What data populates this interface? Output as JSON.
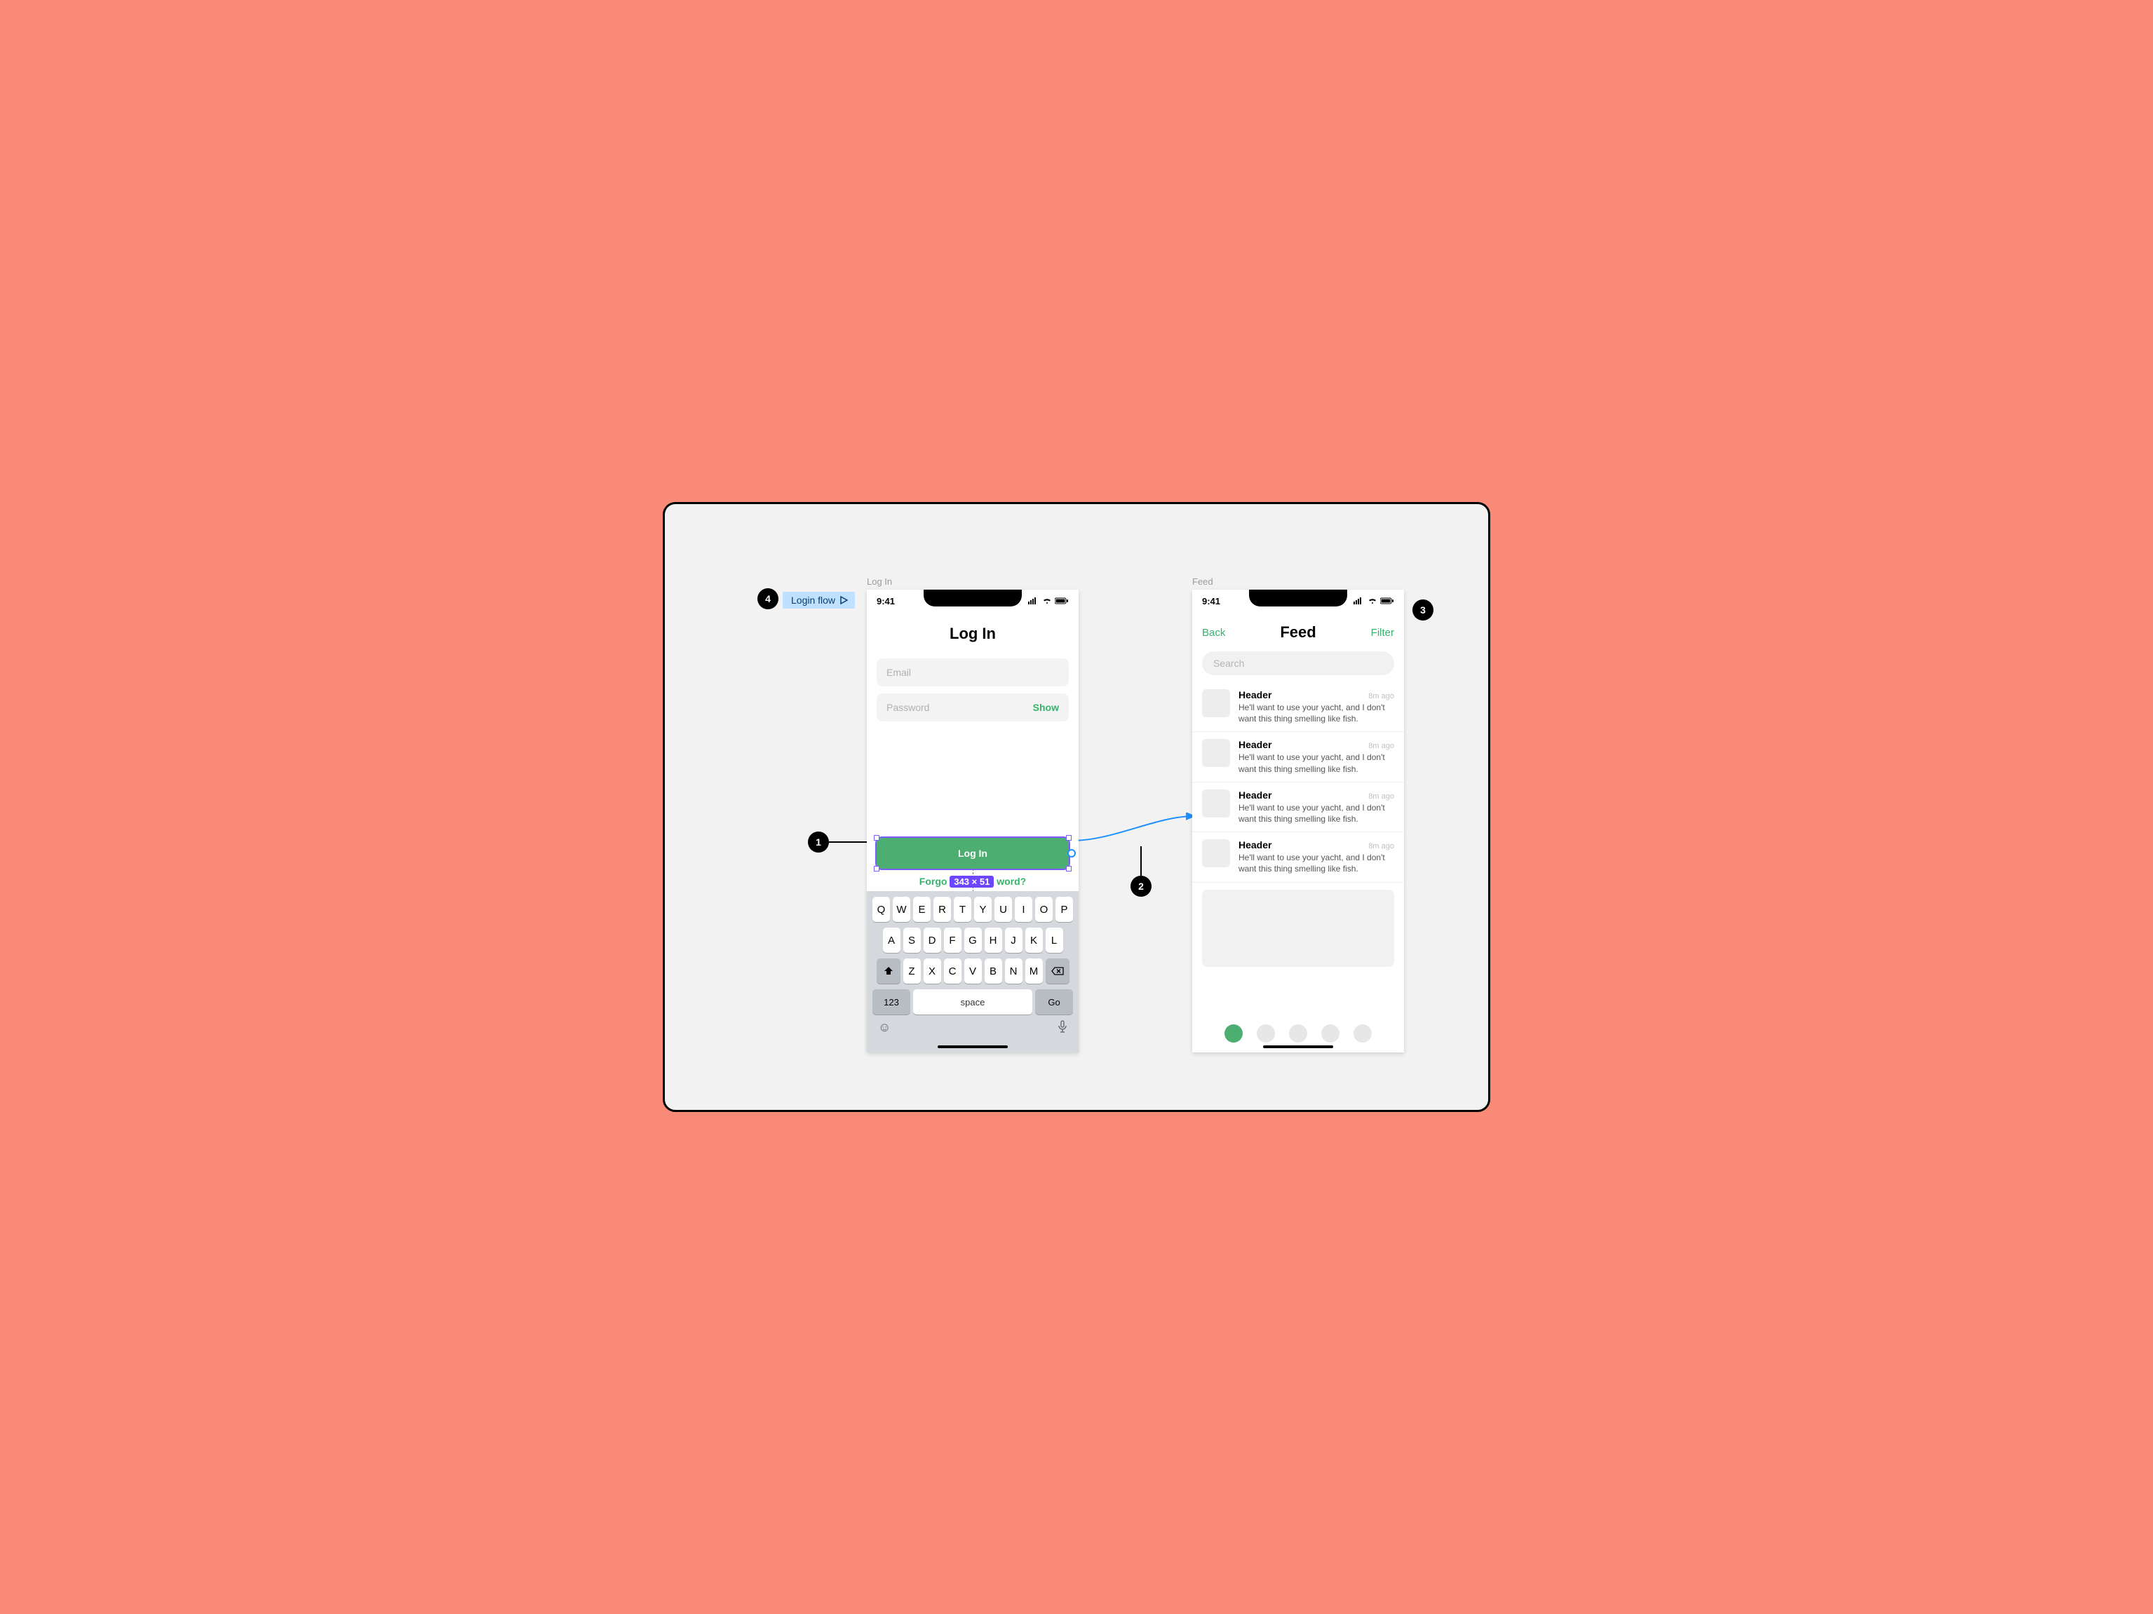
{
  "flow_chip": "Login flow",
  "frame_labels": {
    "login": "Log In",
    "feed": "Feed"
  },
  "annotations": [
    "1",
    "2",
    "3",
    "4"
  ],
  "statusbar": {
    "time": "9:41"
  },
  "login": {
    "title": "Log In",
    "email_placeholder": "Email",
    "password_placeholder": "Password",
    "show": "Show",
    "button": "Log In",
    "forgot_prefix": "Forgo",
    "forgot_suffix": "word?",
    "dim_badge": "343 × 51"
  },
  "keyboard": {
    "row1": [
      "Q",
      "W",
      "E",
      "R",
      "T",
      "Y",
      "U",
      "I",
      "O",
      "P"
    ],
    "row2": [
      "A",
      "S",
      "D",
      "F",
      "G",
      "H",
      "J",
      "K",
      "L"
    ],
    "row3": [
      "Z",
      "X",
      "C",
      "V",
      "B",
      "N",
      "M"
    ],
    "num": "123",
    "space": "space",
    "go": "Go"
  },
  "feed": {
    "back": "Back",
    "title": "Feed",
    "filter": "Filter",
    "search_placeholder": "Search",
    "items": [
      {
        "header": "Header",
        "time": "8m ago",
        "body": "He'll want to use your yacht, and I don't want this thing smelling like fish."
      },
      {
        "header": "Header",
        "time": "8m ago",
        "body": "He'll want to use your yacht, and I don't want this thing smelling like fish."
      },
      {
        "header": "Header",
        "time": "8m ago",
        "body": "He'll want to use your yacht, and I don't want this thing smelling like fish."
      },
      {
        "header": "Header",
        "time": "8m ago",
        "body": "He'll want to use your yacht, and I don't want this thing smelling like fish."
      }
    ]
  }
}
